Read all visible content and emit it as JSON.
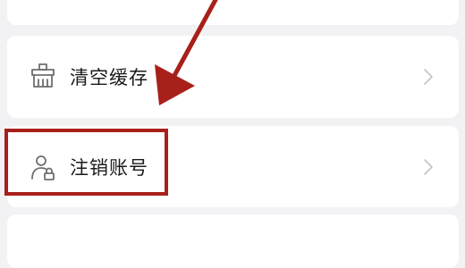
{
  "menu": {
    "items": [
      {
        "label": "清空缓存",
        "icon": "broom-icon"
      },
      {
        "label": "注销账号",
        "icon": "user-lock-icon"
      }
    ]
  },
  "annotation": {
    "color": "#a8201a"
  }
}
